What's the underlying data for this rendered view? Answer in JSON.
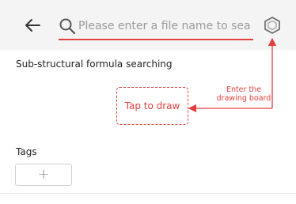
{
  "header": {
    "search": {
      "placeholder": "Please enter a file name to searc"
    },
    "back_icon": "arrow-left-icon",
    "molecule_icon": "hexagon-icon"
  },
  "structure_search": {
    "title": "Sub-structural formula searching",
    "tap_label": "Tap to draw",
    "hint_lines": [
      "Enter the",
      "drawing board"
    ]
  },
  "tags": {
    "title": "Tags",
    "add_label": "+"
  },
  "colors": {
    "accent": "#e2403f",
    "header_bg": "#f4f4f4"
  }
}
